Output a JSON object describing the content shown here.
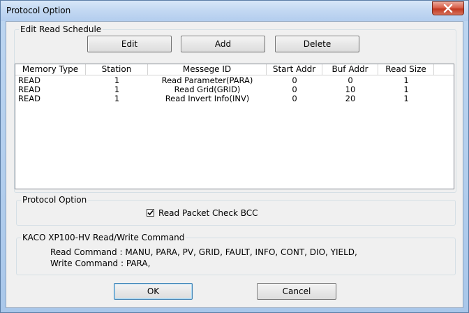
{
  "window": {
    "title": "Protocol Option"
  },
  "schedule_group": {
    "label": "Edit Read Schedule",
    "edit_label": "Edit",
    "add_label": "Add",
    "delete_label": "Delete",
    "columns": [
      "Memory Type",
      "Station",
      "Messege ID",
      "Start Addr",
      "Buf Addr",
      "Read Size"
    ],
    "rows": [
      [
        "READ",
        "1",
        "Read Parameter(PARA)",
        "0",
        "0",
        "1"
      ],
      [
        "READ",
        "1",
        "Read Grid(GRID)",
        "0",
        "10",
        "1"
      ],
      [
        "READ",
        "1",
        "Read Invert Info(INV)",
        "0",
        "20",
        "1"
      ]
    ]
  },
  "protocol_group": {
    "label": "Protocol Option",
    "bcc_label": "Read Packet Check BCC",
    "bcc_checked": true
  },
  "command_group": {
    "label": "KACO XP100-HV Read/Write Command",
    "read_command": "Read Command : MANU, PARA, PV, GRID, FAULT, INFO, CONT, DIO, YIELD,",
    "write_command": "Write Command : PARA,"
  },
  "footer": {
    "ok_label": "OK",
    "cancel_label": "Cancel"
  },
  "icons": {
    "close": "close-icon",
    "check": "check-icon"
  }
}
